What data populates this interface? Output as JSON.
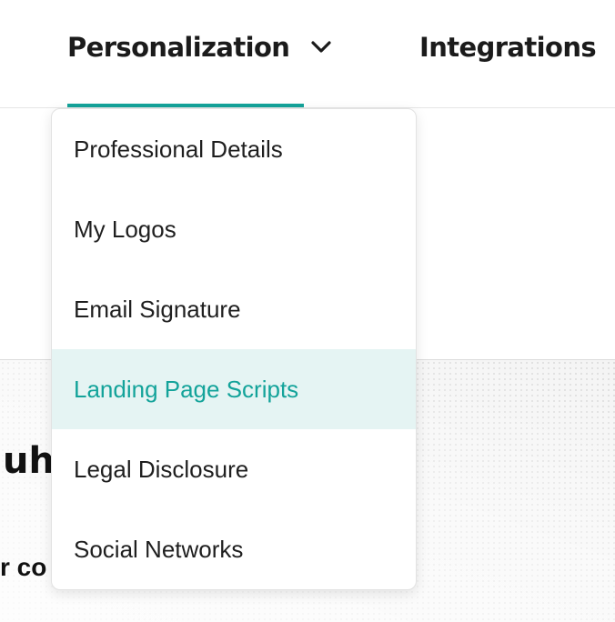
{
  "nav": {
    "tabs": [
      {
        "label": "Personalization",
        "active": true,
        "has_dropdown": true
      },
      {
        "label": "Integrations",
        "active": false,
        "has_dropdown": false
      }
    ]
  },
  "dropdown": {
    "items": [
      {
        "label": "Professional Details",
        "highlighted": false
      },
      {
        "label": "My Logos",
        "highlighted": false
      },
      {
        "label": "Email Signature",
        "highlighted": false
      },
      {
        "label": "Landing Page Scripts",
        "highlighted": true
      },
      {
        "label": "Legal Disclosure",
        "highlighted": false
      },
      {
        "label": "Social Networks",
        "highlighted": false
      }
    ]
  },
  "hero": {
    "heading_fragment": "uh!",
    "subtext_fragment": "r co"
  },
  "colors": {
    "accent": "#14a39a",
    "highlight_bg": "#e5f4f3",
    "text": "#1f1f1f"
  },
  "icons": {
    "dropdown_indicator": "chevron-down-icon"
  }
}
